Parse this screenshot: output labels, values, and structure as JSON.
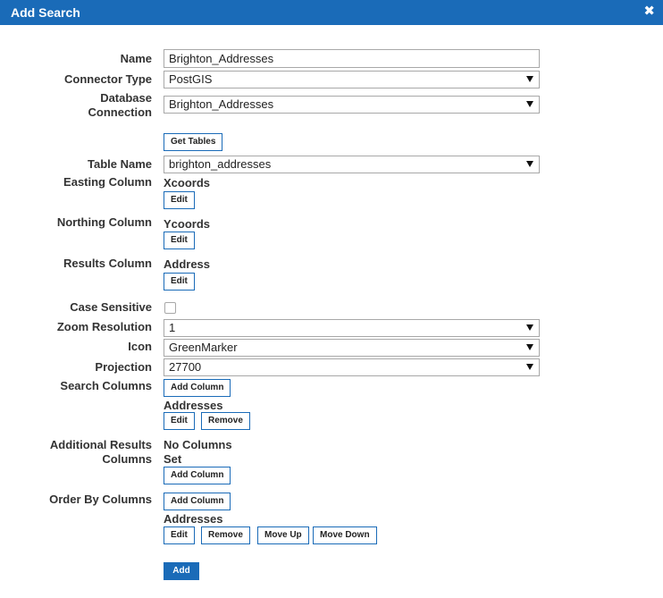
{
  "dialog": {
    "title": "Add Search",
    "close_glyph": "✖"
  },
  "labels": {
    "name": "Name",
    "connector_type": "Connector Type",
    "database_connection_line1": "Database",
    "database_connection_line2": "Connection",
    "table_name": "Table Name",
    "easting_column": "Easting Column",
    "northing_column": "Northing Column",
    "results_column": "Results Column",
    "case_sensitive": "Case Sensitive",
    "zoom_resolution": "Zoom Resolution",
    "icon": "Icon",
    "projection": "Projection",
    "search_columns": "Search Columns",
    "additional_results_line1": "Additional Results",
    "additional_results_line2": "Columns",
    "order_by_columns": "Order By Columns"
  },
  "fields": {
    "name_value": "Brighton_Addresses",
    "connector_type": "PostGIS",
    "database_connection": "Brighton_Addresses",
    "table_name": "brighton_addresses",
    "easting_column": "Xcoords",
    "northing_column": "Ycoords",
    "results_column": "Address",
    "case_sensitive": false,
    "zoom_resolution": "1",
    "icon": "GreenMarker",
    "projection": "27700",
    "search_columns_item": "Addresses",
    "additional_results_line1": "No Columns",
    "additional_results_line2": "Set",
    "order_by_item": "Addresses"
  },
  "buttons": {
    "get_tables": "Get Tables",
    "edit": "Edit",
    "remove": "Remove",
    "add_column": "Add Column",
    "move_up": "Move Up",
    "move_down": "Move Down",
    "add": "Add"
  },
  "colors": {
    "accent": "#1a6bb8",
    "text": "#333333"
  }
}
